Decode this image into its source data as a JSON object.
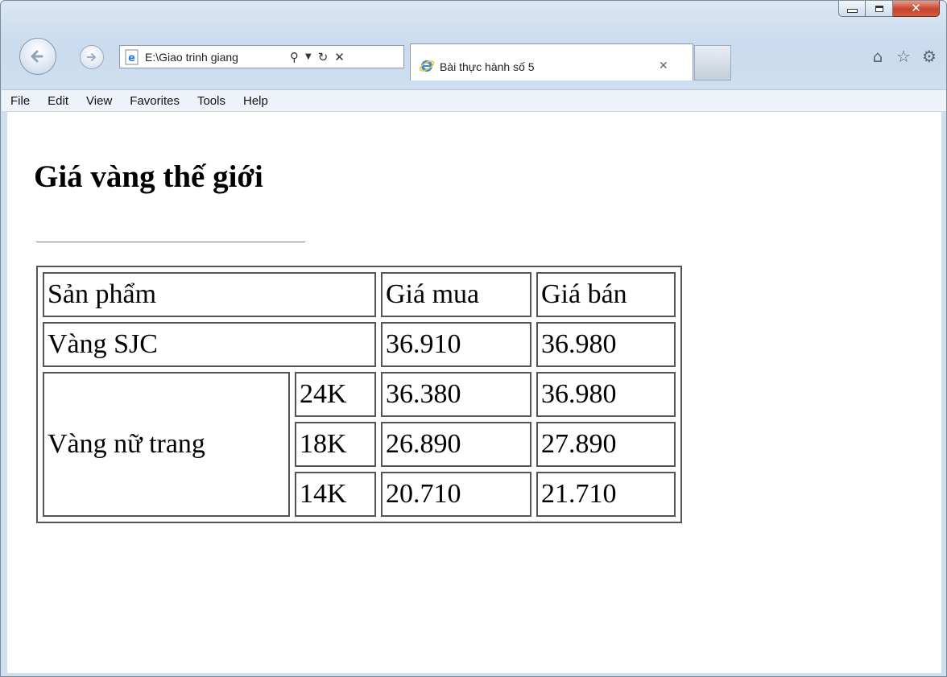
{
  "browser": {
    "address_url": "E:\\Giao trinh giang",
    "tab_title": "Bài thực hành số 5",
    "menu": [
      "File",
      "Edit",
      "View",
      "Favorites",
      "Tools",
      "Help"
    ]
  },
  "page": {
    "heading": "Giá vàng thế giới",
    "table": {
      "header": [
        "Sản phẩm",
        "Giá mua",
        "Giá bán"
      ],
      "row_sjc": {
        "product": "Vàng SJC",
        "buy": "36.910",
        "sell": "36.980"
      },
      "jewelry": {
        "product": "Vàng nữ trang",
        "rows": [
          {
            "karat": "24K",
            "buy": "36.380",
            "sell": "36.980"
          },
          {
            "karat": "18K",
            "buy": "26.890",
            "sell": "27.890"
          },
          {
            "karat": "14K",
            "buy": "20.710",
            "sell": "21.710"
          }
        ]
      }
    }
  },
  "colors": {
    "close_button": "#c8442c",
    "chrome": "#c9dbee",
    "menubar": "#eef3fa",
    "table_border": "#555555"
  }
}
